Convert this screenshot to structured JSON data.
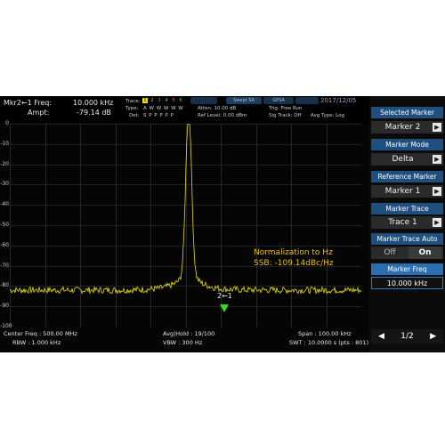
{
  "header": {
    "marker_freq_label": "Mkr2←1 Freq:",
    "marker_freq_value": "10.000 kHz",
    "marker_ampt_label": "Ampt:",
    "marker_ampt_value": "-79.14 dB",
    "trace_label": "Trace:",
    "trace_numbers": [
      "1",
      "2",
      "3",
      "4",
      "5",
      "6"
    ],
    "type_label": "Type:",
    "type_values": "A W W W W W",
    "det_label": "Det:",
    "det_values": "S P P P P P",
    "tabs": [
      "Swept SA",
      "GPSA",
      "",
      ""
    ],
    "atten": "Atten: 10.00 dB",
    "ref_level": "Ref Level: 0.00 dBm",
    "trig": "Trig: Free Run",
    "sig_track": "Sig Track: Off",
    "avg_type": "Avg Type: Log",
    "date": "2017/12/05"
  },
  "plot": {
    "y_ticks": [
      "0",
      "-10",
      "-20",
      "-30",
      "-40",
      "-50",
      "-60",
      "-70",
      "-80",
      "-90",
      "-100"
    ],
    "annotation_line1": "Normalization to Hz",
    "annotation_line2": "SSB:  -109.14dBc/Hz",
    "marker_label": "2←1"
  },
  "footer": {
    "center_freq": "Center Freq : 500.00 MHz",
    "avg_hold": "Avg|Hold : 19/100",
    "span": "Span : 100.00 kHz",
    "rbw": "RBW : 1.000 kHz",
    "vbw": "VBW : 300 Hz",
    "swt": "SWT : 10.0000 s (pts : 801)"
  },
  "panel": {
    "items": [
      {
        "title": "Selected Marker",
        "value": "Marker 2"
      },
      {
        "title": "Marker Mode",
        "value": "Delta"
      },
      {
        "title": "Reference Marker",
        "value": "Marker 1"
      },
      {
        "title": "Marker Trace",
        "value": "Trace 1"
      }
    ],
    "auto_title": "Marker Trace Auto",
    "auto_off": "Off",
    "auto_on": "On",
    "freq_title": "Marker Freq",
    "freq_value": "10.000 kHz",
    "page": "1/2",
    "arrow_glyph": "▶",
    "prev_glyph": "◀",
    "next_glyph": "▶"
  },
  "colors": {
    "trace": "#e8e000",
    "grid": "#3c3c3c",
    "accent": "#1e4f7e",
    "marker": "#33dd22"
  }
}
